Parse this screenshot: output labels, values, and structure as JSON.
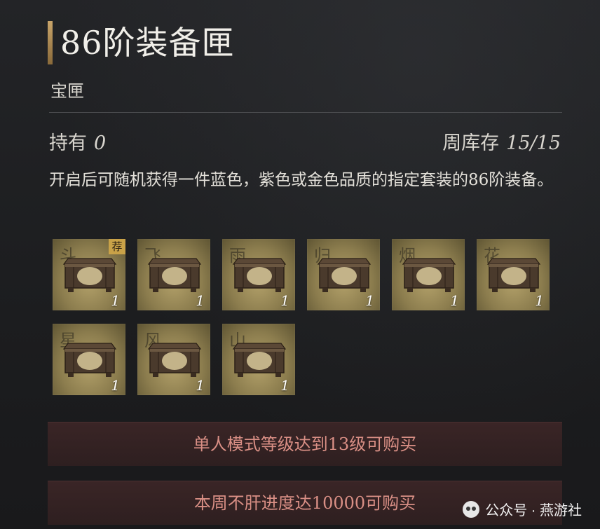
{
  "header": {
    "title": "86阶装备匣",
    "subtitle": "宝匣"
  },
  "stats": {
    "owned_label": "持有",
    "owned_value": "0",
    "weekly_stock_label": "周库存",
    "weekly_stock_value": "15/15"
  },
  "description": "开启后可随机获得一件蓝色，紫色或金色品质的指定套装的86阶装备。",
  "items": [
    {
      "char": "斗",
      "count": "1",
      "badge": "荐"
    },
    {
      "char": "飞",
      "count": "1"
    },
    {
      "char": "雨",
      "count": "1"
    },
    {
      "char": "归",
      "count": "1"
    },
    {
      "char": "烟",
      "count": "1"
    },
    {
      "char": "花",
      "count": "1"
    },
    {
      "char": "星",
      "count": "1"
    },
    {
      "char": "风",
      "count": "1"
    },
    {
      "char": "山",
      "count": "1"
    }
  ],
  "purchase_conditions": [
    "单人模式等级达到13级可购买",
    "本周不肝进度达10000可购买"
  ],
  "watermark": {
    "text": "公众号 · 燕游社",
    "icon": "wechat-icon"
  },
  "colors": {
    "accent_gold": "#c9a56a",
    "button_text": "#d98f85",
    "badge": "#c9a248"
  }
}
